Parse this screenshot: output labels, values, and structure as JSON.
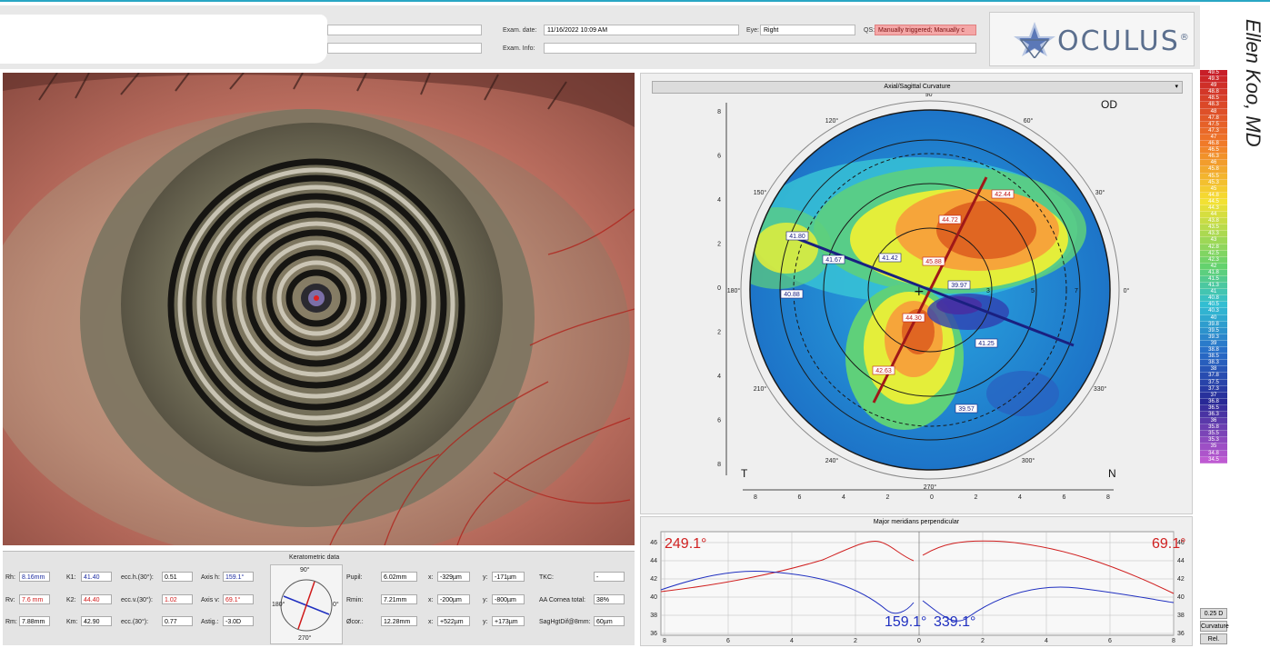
{
  "header": {
    "exam_date_label": "Exam. date:",
    "exam_date_value": "11/16/2022 10:09 AM",
    "eye_label": "Eye:",
    "eye_value": "Right",
    "qs_label": "QS:",
    "qs_value": "Manually triggered; Manually c",
    "exam_info_label": "Exam. Info:",
    "exam_info_value": ""
  },
  "logo": {
    "text": "OCULUS",
    "mark": "®",
    "icon": "oculus-star-icon"
  },
  "signature": "Ellen Koo, MD",
  "keratometric": {
    "title": "Keratometric data",
    "rows": [
      {
        "l1": "Rh:",
        "v1": "8.16mm",
        "l2": "K1:",
        "v2": "41.40",
        "l3": "ecc.h.(30°):",
        "v3": "0.51",
        "l4": "Axis h:",
        "v4": "159.1°"
      },
      {
        "l1": "Rv:",
        "v1": "7.6 mm",
        "l2": "K2:",
        "v2": "44.40",
        "l3": "ecc.v.(30°):",
        "v3": "1.02",
        "l4": "Axis v:",
        "v4": "69.1°"
      },
      {
        "l1": "Rm:",
        "v1": "7.88mm",
        "l2": "Km:",
        "v2": "42.90",
        "l3": "ecc.(30°):",
        "v3": "0.77",
        "l4": "Astig.:",
        "v4": "-3.0D"
      }
    ],
    "dial": {
      "top": "90°",
      "bottom": "270°",
      "left": "180°",
      "right": "0°"
    },
    "right_rows": [
      {
        "l1": "Pupil:",
        "v1": "6.02mm",
        "l2": "x:",
        "v2": "-329µm",
        "l3": "y:",
        "v3": "-171µm",
        "l4": "TKC:",
        "v4": "-"
      },
      {
        "l1": "Rmin:",
        "v1": "7.21mm",
        "l2": "x:",
        "v2": "-200µm",
        "l3": "y:",
        "v3": "-800µm",
        "l4": "AA Cornea total:",
        "v4": "38%"
      },
      {
        "l1": "Øcor.:",
        "v1": "12.28mm",
        "l2": "x:",
        "v2": "+522µm",
        "l3": "y:",
        "v3": "+173µm",
        "l4": "SagHgtDif@8mm:",
        "v4": "60µm"
      }
    ]
  },
  "topography": {
    "dropdown": "Axial/Sagittal Curvature",
    "eye_label": "OD",
    "left_label": "T",
    "right_label": "N",
    "angle_labels": [
      "90°",
      "60°",
      "30°",
      "0°",
      "330°",
      "300°",
      "270°",
      "240°",
      "210°",
      "180°",
      "150°",
      "120°"
    ],
    "y_ticks": [
      "8",
      "6",
      "4",
      "2",
      "0",
      "2",
      "4",
      "6",
      "8"
    ],
    "x_ticks": [
      "8",
      "6",
      "4",
      "2",
      "0",
      "2",
      "4",
      "6",
      "8"
    ],
    "ring_labels": [
      "3",
      "5",
      "7"
    ],
    "steep_values": [
      "42.44",
      "44.72",
      "45.88",
      "44.30",
      "42.63"
    ],
    "flat_values": [
      "41.80",
      "41.67",
      "41.42",
      "40.88",
      "39.97",
      "41.25",
      "39.57"
    ]
  },
  "meridians": {
    "title": "Major meridians perpendicular",
    "y_ticks": [
      "46",
      "44",
      "42",
      "40",
      "38",
      "36"
    ],
    "x_ticks": [
      "8",
      "6",
      "4",
      "2",
      "0",
      "2",
      "4",
      "6",
      "8"
    ],
    "label_steep_left": "249.1°",
    "label_steep_right": "69.1°",
    "label_flat_left": "159.1°",
    "label_flat_right": "339.1°"
  },
  "scale": {
    "values": [
      "49.5",
      "49.3",
      "49",
      "48.8",
      "48.5",
      "48.3",
      "48",
      "47.8",
      "47.5",
      "47.3",
      "47",
      "46.8",
      "46.5",
      "46.3",
      "46",
      "45.8",
      "45.5",
      "45.3",
      "45",
      "44.8",
      "44.5",
      "44.3",
      "44",
      "43.8",
      "43.5",
      "43.3",
      "43",
      "42.8",
      "42.5",
      "42.3",
      "42",
      "41.8",
      "41.5",
      "41.3",
      "41",
      "40.8",
      "40.5",
      "40.3",
      "40",
      "39.8",
      "39.5",
      "39.3",
      "39",
      "38.8",
      "38.5",
      "38.3",
      "38",
      "37.8",
      "37.5",
      "37.3",
      "37",
      "36.8",
      "36.5",
      "36.3",
      "36",
      "35.8",
      "35.5",
      "35.3",
      "35",
      "34.8",
      "34.5"
    ],
    "step_label": "0.25 D",
    "mode_label": "Curvature",
    "ref_label": "Rel."
  }
}
